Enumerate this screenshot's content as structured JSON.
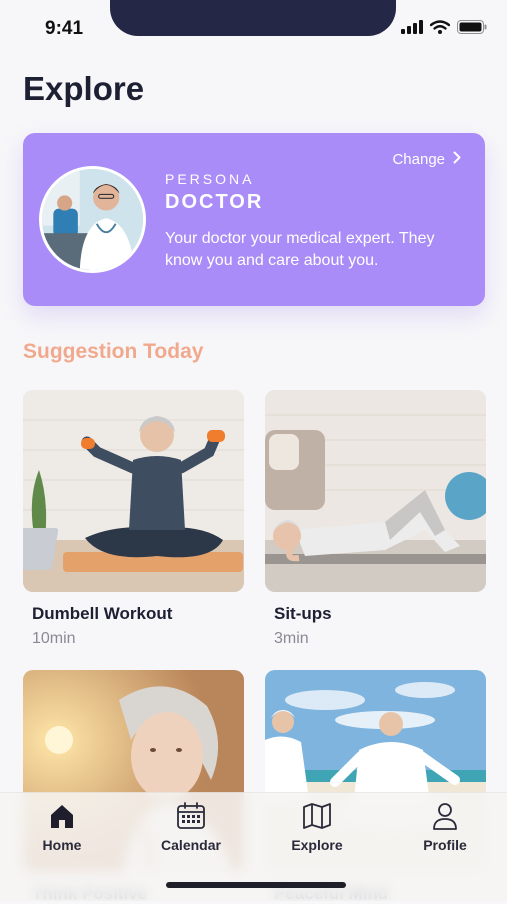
{
  "status": {
    "time": "9:41"
  },
  "page": {
    "title": "Explore"
  },
  "persona": {
    "change_label": "Change",
    "eyebrow": "PERSONA",
    "name": "DOCTOR",
    "description": "Your doctor your medical expert. They know you and care about you."
  },
  "suggestions": {
    "title": "Suggestion Today",
    "items": [
      {
        "title": "Dumbell Workout",
        "duration": "10min"
      },
      {
        "title": "Sit-ups",
        "duration": "3min"
      },
      {
        "title": "Think Positive",
        "duration": ""
      },
      {
        "title": "Peaceful Mind",
        "duration": ""
      }
    ]
  },
  "tabbar": {
    "items": [
      {
        "label": "Home",
        "icon": "home-icon"
      },
      {
        "label": "Calendar",
        "icon": "calendar-icon"
      },
      {
        "label": "Explore",
        "icon": "map-icon"
      },
      {
        "label": "Profile",
        "icon": "user-icon"
      }
    ]
  },
  "colors": {
    "persona_card": "#a98cf7",
    "section_title": "#f1a98e",
    "notch": "#242746"
  }
}
